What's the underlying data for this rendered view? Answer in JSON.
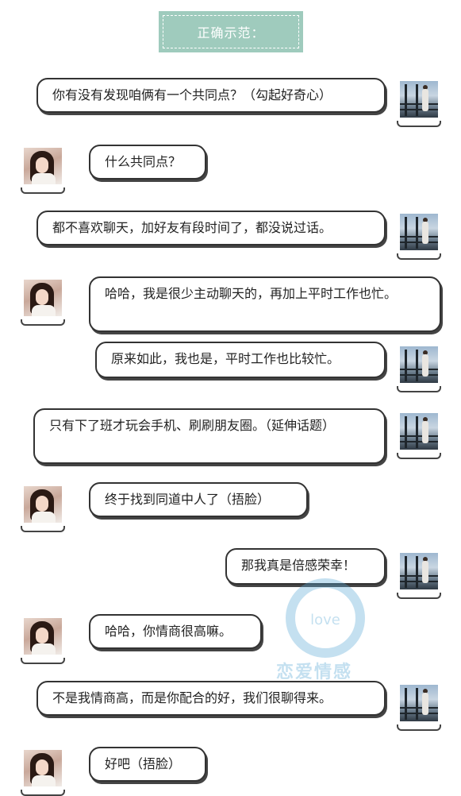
{
  "header": {
    "title": "正确示范："
  },
  "messages": [
    {
      "side": "right",
      "text": "你有没有发现咱俩有一个共同点？（勾起好奇心）"
    },
    {
      "side": "left",
      "text": "什么共同点？"
    },
    {
      "side": "right",
      "text": "都不喜欢聊天，加好友有段时间了，都没说过话。"
    },
    {
      "side": "left",
      "text": "哈哈，我是很少主动聊天的，再加上平时工作也忙。"
    },
    {
      "side": "right",
      "text": "原来如此，我也是，平时工作也比较忙。"
    },
    {
      "side": "right",
      "text": "只有下了班才玩会手机、刷刷朋友圈。（延伸话题）"
    },
    {
      "side": "left",
      "text": "终于找到同道中人了（捂脸）"
    },
    {
      "side": "right",
      "text": "那我真是倍感荣幸！"
    },
    {
      "side": "left",
      "text": "哈哈，你情商很高嘛。"
    },
    {
      "side": "right",
      "text": "不是我情商高，而是你配合的好，我们很聊得来。"
    },
    {
      "side": "left",
      "text": "好吧（捂脸）"
    }
  ],
  "watermark": {
    "text": "恋爱情感",
    "logo_text": "love",
    "color": "#5aa9d6"
  },
  "colors": {
    "header_bg": "#9fcbbd",
    "bubble_border": "#333333"
  }
}
